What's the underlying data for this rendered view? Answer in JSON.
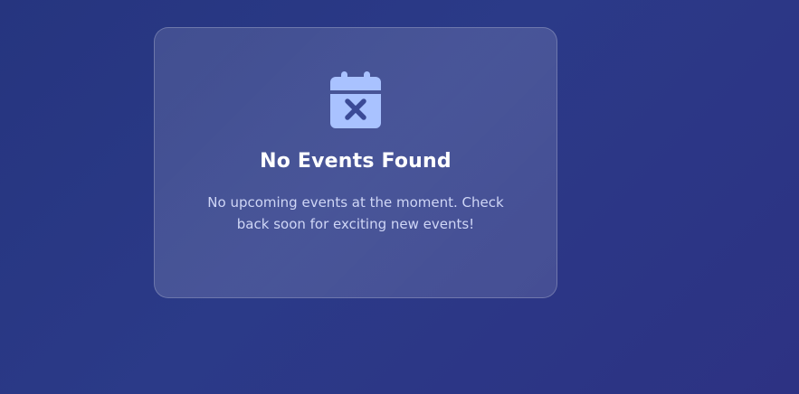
{
  "empty_state": {
    "icon": "calendar-x-icon",
    "title": "No Events Found",
    "message": "No upcoming events at the moment. Check back soon for exciting new events!"
  },
  "colors": {
    "background": "#2b3a88",
    "card_fill": "rgba(255,255,255,0.12)",
    "icon_fill": "#a9c2ff",
    "icon_mark": "#3b4a96",
    "title": "#ffffff",
    "message": "#cfd6f6"
  }
}
